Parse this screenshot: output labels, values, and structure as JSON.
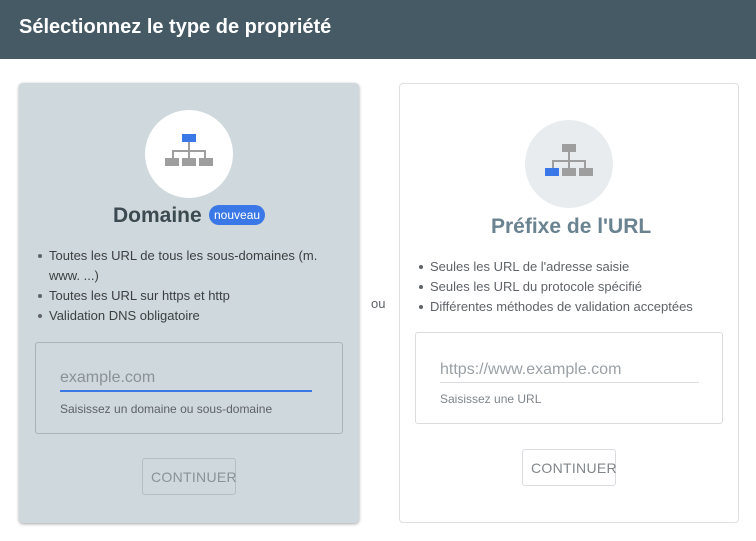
{
  "header": {
    "title": "Sélectionnez le type de propriété"
  },
  "separator": "ou",
  "domain_card": {
    "icon": "sitemap-icon",
    "title": "Domaine",
    "badge": "nouveau",
    "features": [
      "Toutes les URL de tous les sous-domaines (m. www. ...)",
      "Toutes les URL sur https et http",
      "Validation DNS obligatoire"
    ],
    "input": {
      "value": "",
      "placeholder": "example.com"
    },
    "helper": "Saisissez un domaine ou sous-domaine",
    "button": "CONTINUER"
  },
  "url_card": {
    "icon": "sitemap-icon",
    "title": "Préfixe de l'URL",
    "features": [
      "Seules les URL de l'adresse saisie",
      "Seules les URL du protocole spécifié",
      "Différentes méthodes de validation acceptées"
    ],
    "input": {
      "value": "",
      "placeholder": "https://www.example.com"
    },
    "helper": "Saisissez une URL",
    "button": "CONTINUER"
  },
  "colors": {
    "header": "#455a64",
    "accent": "#3b78e7",
    "selected_card": "#cfd8dc"
  }
}
